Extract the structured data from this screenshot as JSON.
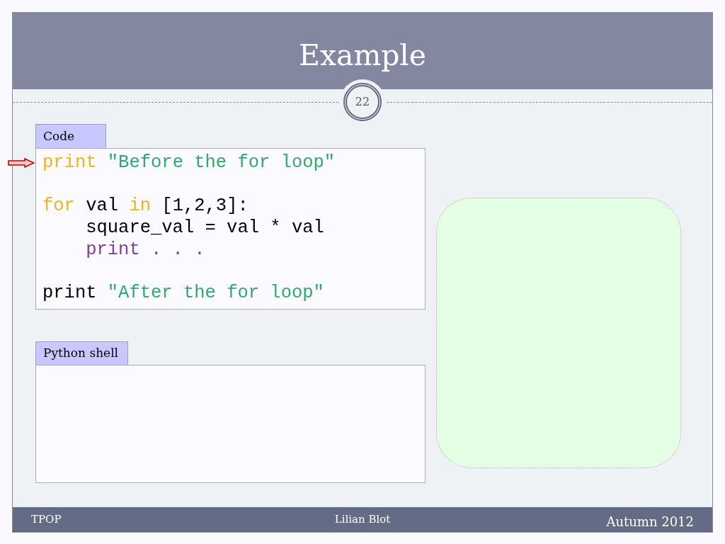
{
  "slide": {
    "title": "Example",
    "page_number": "22"
  },
  "code_panel": {
    "tab": "Code",
    "lines": [
      {
        "kind": "code",
        "current": true,
        "tokens": [
          {
            "text": "print",
            "color": "#f0b21e"
          },
          {
            "text": "\"Before the for loop\"",
            "color": "#2faa6e"
          }
        ]
      },
      {
        "kind": "blank"
      },
      {
        "kind": "code",
        "current": false,
        "tokens": [
          {
            "text": "for",
            "color": "#f0b21e"
          },
          {
            "text": "val",
            "color": "#000000"
          },
          {
            "text": "in",
            "color": "#f0b21e"
          },
          {
            "text": "[1,2,3]:",
            "color": "#000000"
          }
        ],
        "children": [
          {
            "kind": "code",
            "current": false,
            "tokens": [
              {
                "text": "square_val = val * val",
                "color": "#000000"
              }
            ]
          },
          {
            "kind": "code",
            "current": false,
            "tokens": [
              {
                "text": "print . . .",
                "color": "#7e3f9f"
              }
            ]
          }
        ]
      },
      {
        "kind": "blank"
      },
      {
        "kind": "code",
        "current": false,
        "tokens": [
          {
            "text": "print",
            "color": "#000000"
          },
          {
            "text": "\"After the for loop\"",
            "color": "#2faa6e"
          }
        ]
      }
    ]
  },
  "shell_panel": {
    "tab": "Python shell"
  },
  "footer": {
    "left": "TPOP",
    "center": "Lilian Blot",
    "right": "Autumn 2012"
  }
}
